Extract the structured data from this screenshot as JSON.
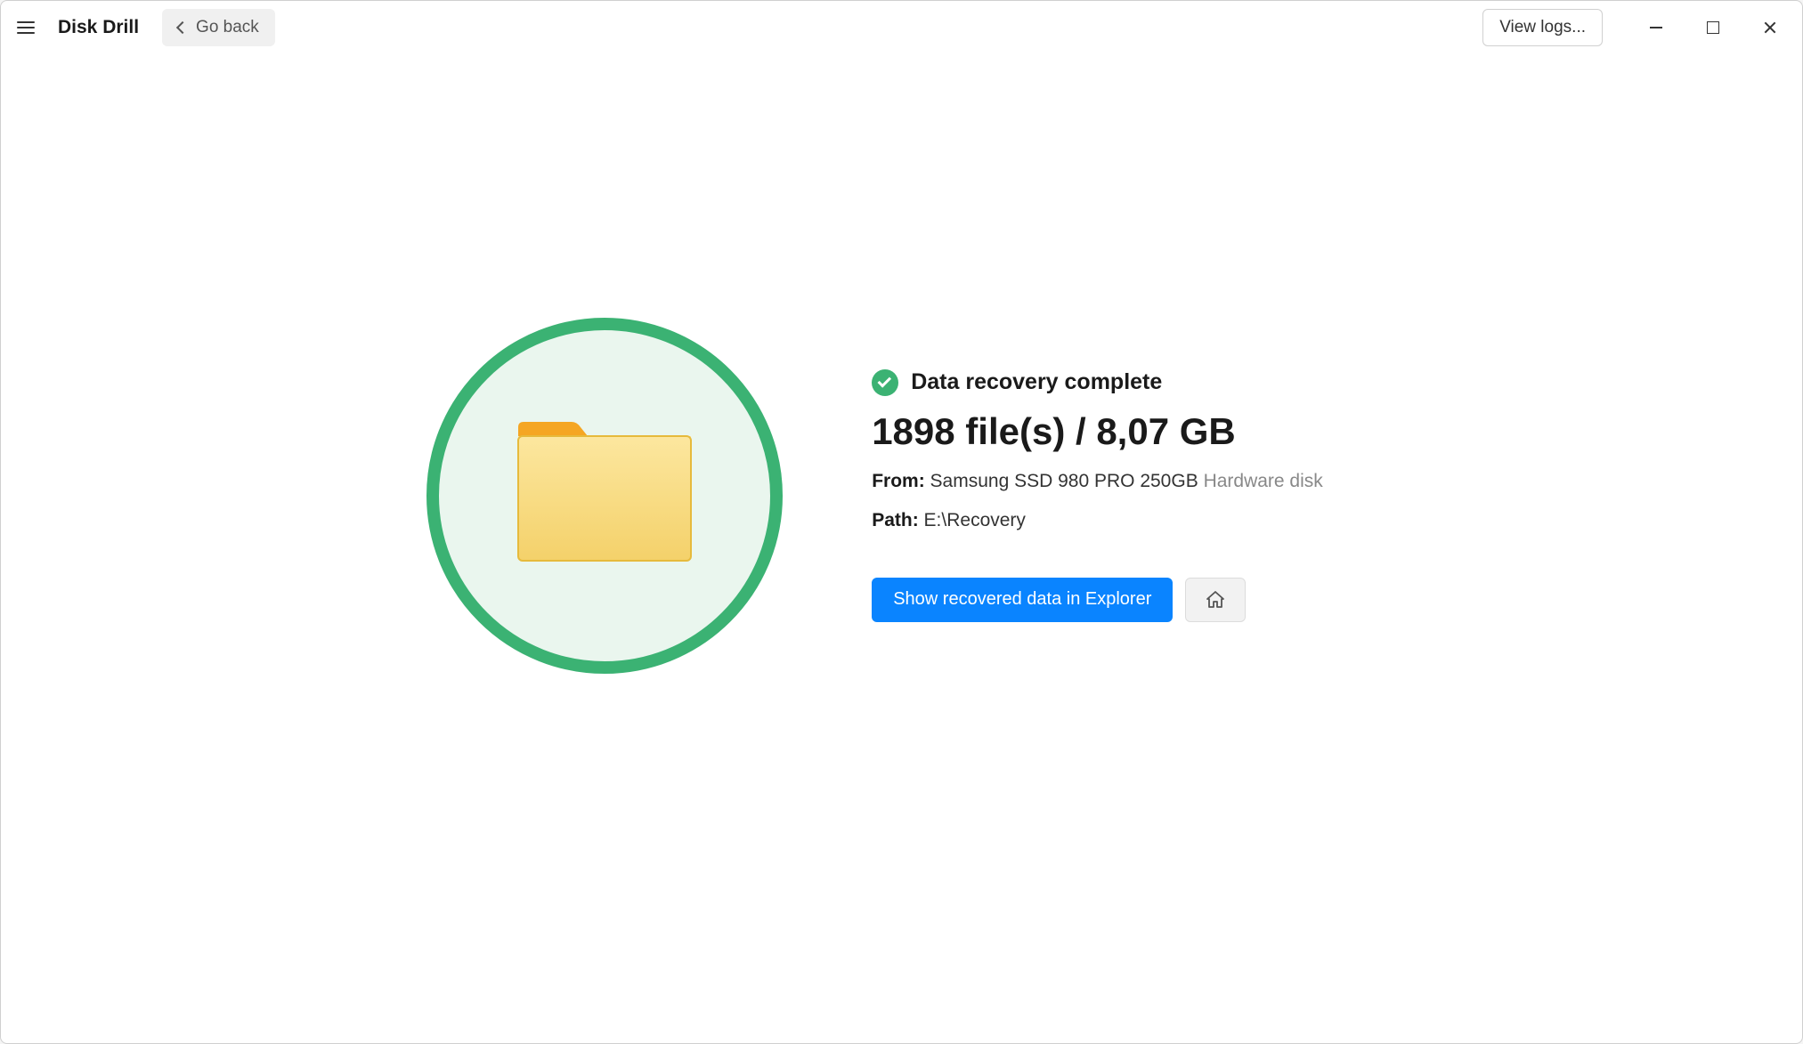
{
  "header": {
    "app_title": "Disk Drill",
    "go_back_label": "Go back",
    "view_logs_label": "View logs..."
  },
  "status": {
    "title": "Data recovery complete",
    "heading": "1898 file(s) / 8,07 GB"
  },
  "details": {
    "from_label": "From:",
    "from_value": "Samsung SSD 980 PRO 250GB",
    "from_type": "Hardware disk",
    "path_label": "Path:",
    "path_value": "E:\\Recovery"
  },
  "actions": {
    "show_in_explorer": "Show recovered data in Explorer"
  }
}
